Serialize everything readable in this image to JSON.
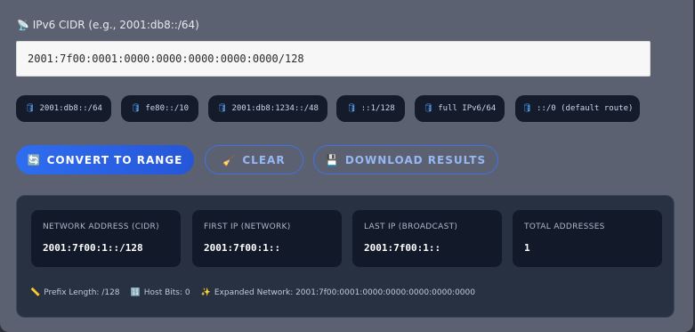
{
  "field": {
    "label": "IPv6 CIDR (e.g., 2001:db8::/64)",
    "icon": "satellite-antenna-icon",
    "value": "2001:7f00:0001:0000:0000:0000:0000:0000/128"
  },
  "presets": [
    {
      "label": "2001:db8::/64"
    },
    {
      "label": "fe80::/10"
    },
    {
      "label": "2001:db8:1234::/48"
    },
    {
      "label": "::1/128"
    },
    {
      "label": "full IPv6/64"
    },
    {
      "label": "::/0 (default route)"
    }
  ],
  "buttons": {
    "convert": "CONVERT TO RANGE",
    "clear": "CLEAR",
    "download": "DOWNLOAD RESULTS"
  },
  "results": {
    "cards": [
      {
        "label": "NETWORK ADDRESS (CIDR)",
        "value": "2001:7f00:1::/128"
      },
      {
        "label": "FIRST IP (NETWORK)",
        "value": "2001:7f00:1::"
      },
      {
        "label": "LAST IP (BROADCAST)",
        "value": "2001:7f00:1::"
      },
      {
        "label": "TOTAL ADDRESSES",
        "value": "1"
      }
    ],
    "meta": {
      "prefix": "Prefix Length: /128",
      "host_bits": "Host Bits: 0",
      "expanded": "Expanded Network: 2001:7f00:0001:0000:0000:0000:0000:0000"
    }
  },
  "colors": {
    "panel_bg": "#5b6170",
    "chip_bg": "#141b2b",
    "primary": "#2f6df0",
    "card_bg": "#121a2a"
  }
}
